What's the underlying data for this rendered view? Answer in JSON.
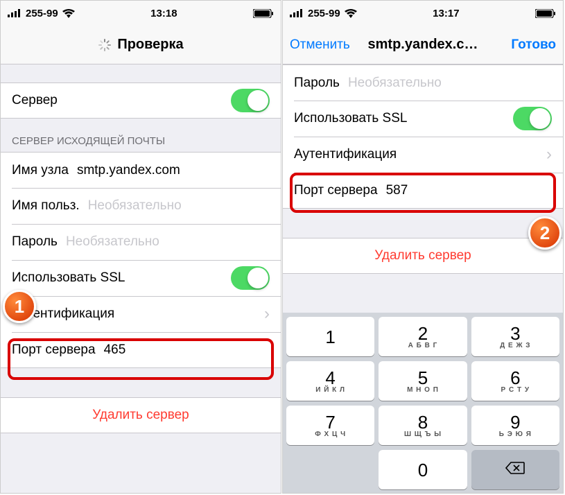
{
  "left": {
    "status": {
      "carrier": "255-99",
      "time": "13:18"
    },
    "nav": {
      "title": "Проверка"
    },
    "server_row": {
      "label": "Сервер"
    },
    "section_header": "Сервер исходящей почты",
    "host": {
      "label": "Имя узла",
      "value": "smtp.yandex.com"
    },
    "user": {
      "label": "Имя польз.",
      "placeholder": "Необязательно"
    },
    "password": {
      "label": "Пароль",
      "placeholder": "Необязательно"
    },
    "ssl": {
      "label": "Использовать SSL"
    },
    "auth": {
      "label": "Аутентификация"
    },
    "port": {
      "label": "Порт сервера",
      "value": "465"
    },
    "delete": "Удалить сервер"
  },
  "right": {
    "status": {
      "carrier": "255-99",
      "time": "13:17"
    },
    "nav": {
      "cancel": "Отменить",
      "title": "smtp.yandex.c…",
      "done": "Готово"
    },
    "password": {
      "label": "Пароль",
      "placeholder": "Необязательно"
    },
    "ssl": {
      "label": "Использовать SSL"
    },
    "auth": {
      "label": "Аутентификация"
    },
    "port": {
      "label": "Порт сервера",
      "value": "587"
    },
    "delete": "Удалить сервер",
    "keypad": {
      "k1": {
        "n": "1",
        "s": ""
      },
      "k2": {
        "n": "2",
        "s": "А Б В Г"
      },
      "k3": {
        "n": "3",
        "s": "Д Е Ж З"
      },
      "k4": {
        "n": "4",
        "s": "И Й К Л"
      },
      "k5": {
        "n": "5",
        "s": "М Н О П"
      },
      "k6": {
        "n": "6",
        "s": "Р С Т У"
      },
      "k7": {
        "n": "7",
        "s": "Ф Х Ц Ч"
      },
      "k8": {
        "n": "8",
        "s": "Ш Щ Ъ Ы"
      },
      "k9": {
        "n": "9",
        "s": "Ь Э Ю Я"
      },
      "k0": {
        "n": "0",
        "s": ""
      }
    }
  },
  "badges": {
    "one": "1",
    "two": "2"
  }
}
